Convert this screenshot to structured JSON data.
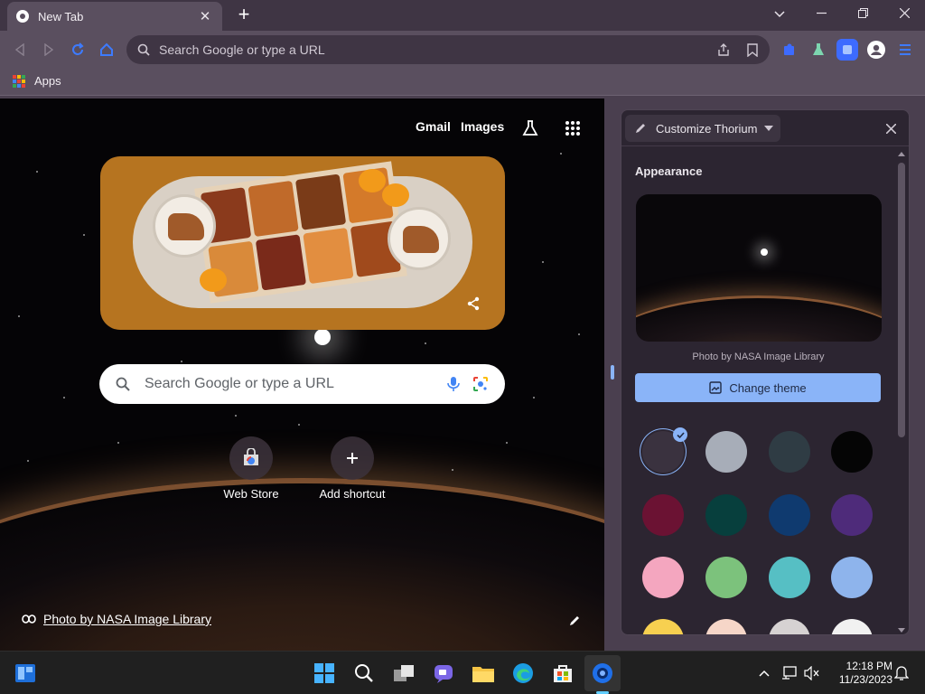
{
  "tab": {
    "title": "New Tab"
  },
  "toolbar": {
    "omnibox_placeholder": "Search Google or type a URL"
  },
  "bookmarks": {
    "apps_label": "Apps"
  },
  "ntp": {
    "links": [
      "Gmail",
      "Images"
    ],
    "search_placeholder": "Search Google or type a URL",
    "shortcuts": [
      {
        "label": "Web Store",
        "icon": "web-store-icon"
      },
      {
        "label": "Add shortcut",
        "icon": "plus-icon"
      }
    ],
    "photo_credit": "Photo by NASA Image Library"
  },
  "side_panel": {
    "title": "Customize Thorium",
    "section_title": "Appearance",
    "preview_credit": "Photo by NASA Image Library",
    "change_theme_label": "Change theme",
    "swatches": [
      {
        "name": "default-theme",
        "color": "#3a323f",
        "selected": true
      },
      {
        "name": "grey",
        "color": "#a7adb8"
      },
      {
        "name": "dark-slate",
        "color": "#2f3c44"
      },
      {
        "name": "black",
        "color": "#050505"
      },
      {
        "name": "wine",
        "color": "#6b1233"
      },
      {
        "name": "dark-teal",
        "color": "#073f3d"
      },
      {
        "name": "navy",
        "color": "#0f3a6f"
      },
      {
        "name": "purple",
        "color": "#4e2b7a"
      },
      {
        "name": "pink",
        "color": "#f4a6bf"
      },
      {
        "name": "green",
        "color": "#7cc27c"
      },
      {
        "name": "aqua",
        "color": "#56bfc4"
      },
      {
        "name": "light-blue",
        "color": "#8eb4ec"
      },
      {
        "name": "yellow",
        "color": "#f7d050"
      },
      {
        "name": "peach",
        "color": "#f6d6c8"
      },
      {
        "name": "light-grey",
        "color": "#d6d2d2"
      },
      {
        "name": "white",
        "color": "#f1f1f1"
      }
    ]
  },
  "taskbar": {
    "time": "12:18 PM",
    "date": "11/23/2023"
  },
  "colors": {
    "accent": "#8ab4f8",
    "frame": "#3f3544",
    "toolbar": "#5a4f5f",
    "panel": "#2c2531"
  }
}
